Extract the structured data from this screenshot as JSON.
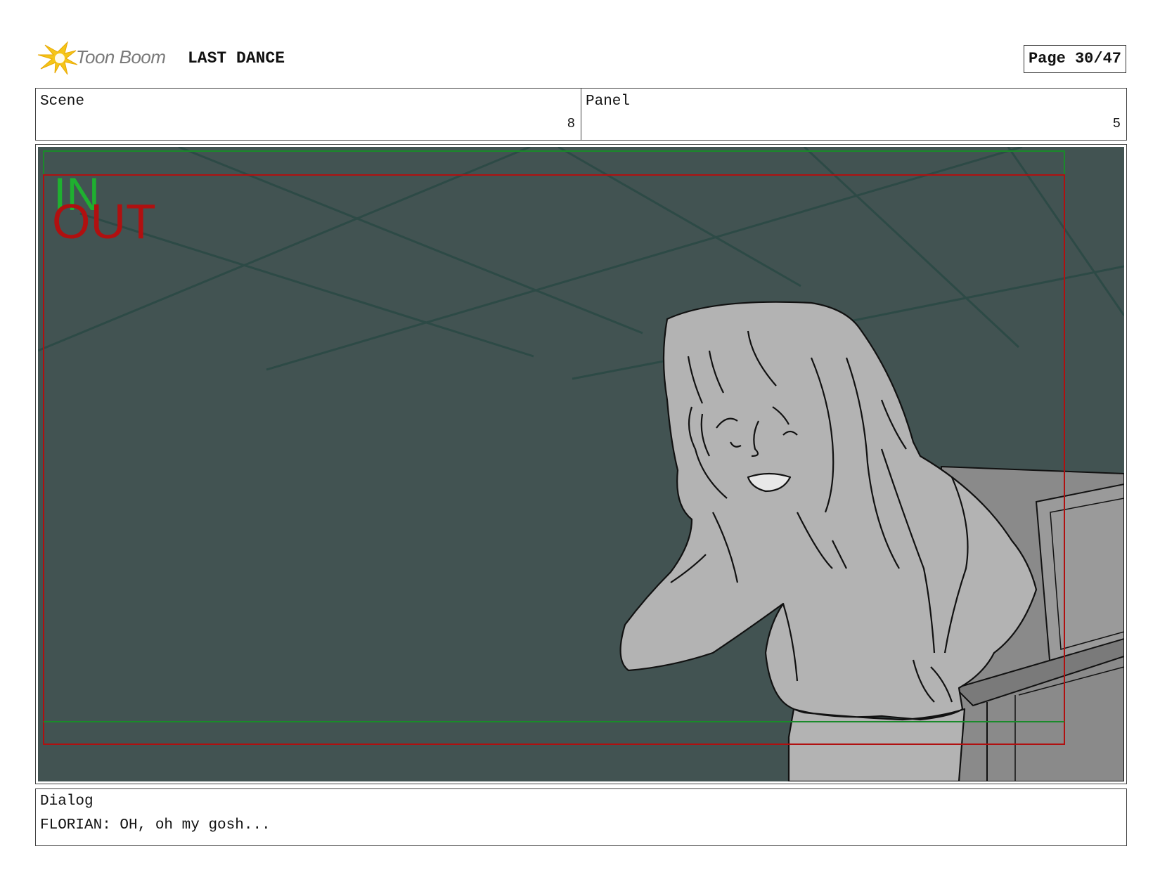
{
  "header": {
    "logo_text": "Toon Boom",
    "project_title": "LAST DANCE",
    "page_label": "Page 30/47"
  },
  "scene": {
    "label": "Scene",
    "value": "8"
  },
  "panel": {
    "label": "Panel",
    "value": "5"
  },
  "frame": {
    "in_label": "IN",
    "out_label": "OUT",
    "colors": {
      "background": "#425352",
      "in_guide": "#1a8a2a",
      "out_guide": "#b01010",
      "figure_fill": "#b3b3b3"
    }
  },
  "dialog": {
    "label": "Dialog",
    "text": "FLORIAN: OH, oh my gosh..."
  }
}
